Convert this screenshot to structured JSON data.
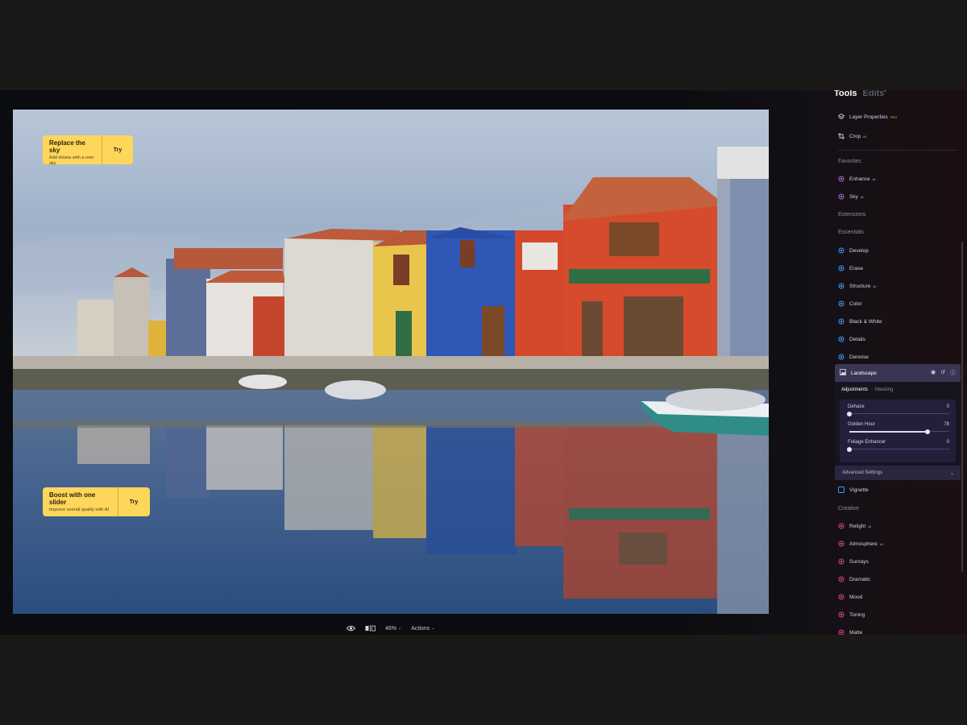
{
  "panel": {
    "tabs": {
      "tools": "Tools",
      "edits": "Edits",
      "edits_marker": "•"
    },
    "layer_properties": {
      "label": "Layer Properties",
      "badge": "PRO"
    },
    "crop": {
      "label": "Crop",
      "badge": "AI"
    },
    "sections": {
      "favorites": "Favorites",
      "extensions": "Extensions",
      "essentials": "Essentials",
      "creative": "Creative"
    },
    "favorites": [
      {
        "label": "Enhance",
        "badge": "AI",
        "color": "#b06be0"
      },
      {
        "label": "Sky",
        "badge": "AI",
        "color": "#b06be0"
      }
    ],
    "essentials": [
      {
        "label": "Develop",
        "badge": "",
        "color": "#3fa0ff"
      },
      {
        "label": "Erase",
        "badge": "",
        "color": "#3fa0ff"
      },
      {
        "label": "Structure",
        "badge": "AI",
        "color": "#3fa0ff"
      },
      {
        "label": "Color",
        "badge": "",
        "color": "#3fa0ff"
      },
      {
        "label": "Black & White",
        "badge": "",
        "color": "#3fa0ff"
      },
      {
        "label": "Details",
        "badge": "",
        "color": "#3fa0ff"
      },
      {
        "label": "Denoise",
        "badge": "",
        "color": "#3fa0ff"
      }
    ],
    "landscape": {
      "label": "Landscape",
      "subtabs": {
        "adjustments": "Adjustments",
        "masking": "Masking"
      },
      "sliders": [
        {
          "label": "Dehaze",
          "value": "0",
          "level": 0
        },
        {
          "label": "Golden Hour",
          "value": "78",
          "level": 0.78
        },
        {
          "label": "Foliage Enhancer",
          "value": "0",
          "level": 0
        }
      ],
      "advanced": "Advanced Settings"
    },
    "vignette": {
      "label": "Vignette",
      "badge": "",
      "color": "#3fa0ff"
    },
    "creative": [
      {
        "label": "Relight",
        "badge": "AI",
        "color": "#e0458f"
      },
      {
        "label": "Atmosphere",
        "badge": "AI",
        "color": "#e0458f"
      },
      {
        "label": "Sunrays",
        "badge": "",
        "color": "#e0458f"
      },
      {
        "label": "Dramatic",
        "badge": "",
        "color": "#e0458f"
      },
      {
        "label": "Mood",
        "badge": "",
        "color": "#e0458f"
      },
      {
        "label": "Toning",
        "badge": "",
        "color": "#e0458f"
      },
      {
        "label": "Matte",
        "badge": "",
        "color": "#e0458f"
      }
    ]
  },
  "promos": {
    "sky": {
      "title": "Replace the sky",
      "subtitle": "Add drama with a new sky",
      "cta": "Try"
    },
    "boost": {
      "title": "Boost with one slider",
      "subtitle": "Improve overall quality with AI",
      "cta": "Try"
    }
  },
  "toolbar": {
    "zoom": "46%",
    "actions": "Actions"
  },
  "colors": {
    "accent": "#3a3553",
    "promo": "#fdd65a",
    "essentials_icon": "#3fa0ff",
    "creative_icon": "#e0458f",
    "ai_icon": "#b06be0"
  }
}
